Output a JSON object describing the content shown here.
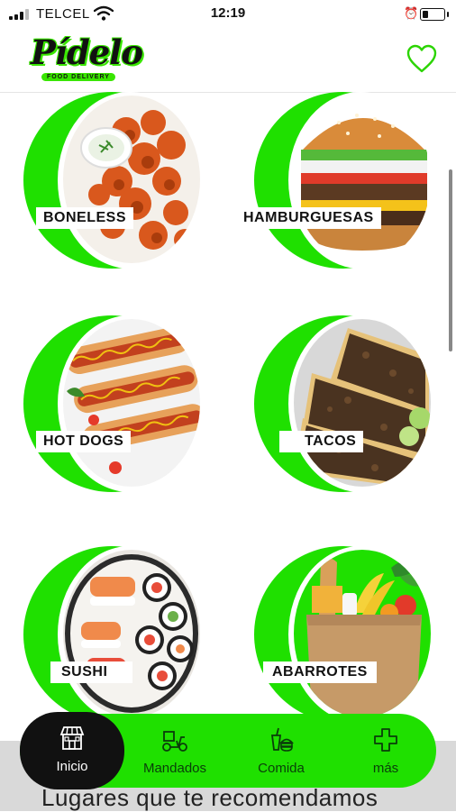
{
  "status_bar": {
    "carrier": "TELCEL",
    "time": "12:19",
    "battery_level": 0.25
  },
  "header": {
    "logo_text": "Pídelo",
    "logo_tagline": "FOOD DELIVERY",
    "favorite_icon": "heart-outline-icon"
  },
  "categories": [
    {
      "label": "BONELESS",
      "image": "boneless-wings-image"
    },
    {
      "label": "HAMBURGUESAS",
      "image": "burger-image"
    },
    {
      "label": "HOT DOGS",
      "image": "hot-dogs-image"
    },
    {
      "label": "TACOS",
      "image": "tacos-image"
    },
    {
      "label": "SUSHI",
      "image": "sushi-image"
    },
    {
      "label": "ABARROTES",
      "image": "groceries-image"
    }
  ],
  "bottom_nav": [
    {
      "label": "Inicio",
      "icon": "store-icon",
      "active": true
    },
    {
      "label": "Mandados",
      "icon": "scooter-icon",
      "active": false
    },
    {
      "label": "Comida",
      "icon": "food-icon",
      "active": false
    },
    {
      "label": "más",
      "icon": "plus-icon",
      "active": false
    }
  ],
  "section_teaser": "Lugares que te recomendamos",
  "colors": {
    "brand_green": "#1fe000",
    "dark": "#111111",
    "teaser_bg": "#d9d9d9"
  }
}
